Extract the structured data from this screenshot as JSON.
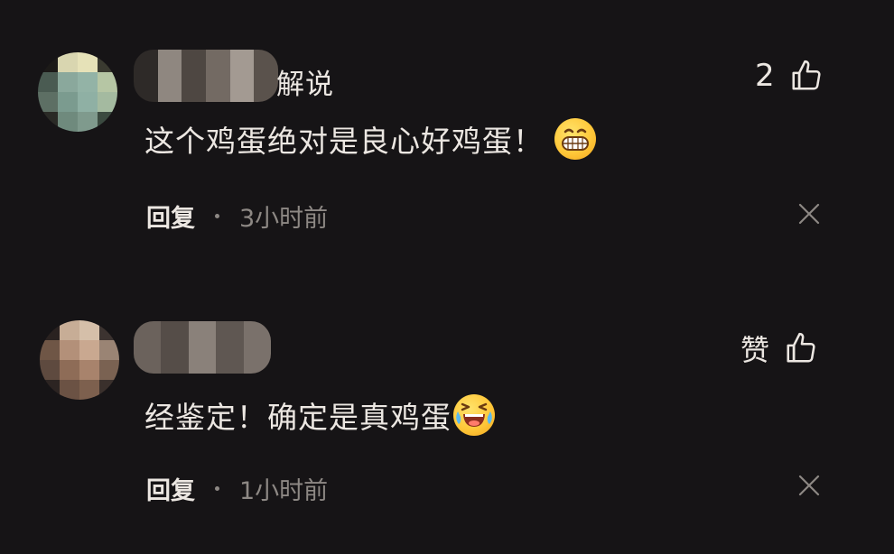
{
  "comments": [
    {
      "username_suffix": "解说",
      "text": "这个鸡蛋绝对是良心好鸡蛋！",
      "emoji": "grinning-face-emoji",
      "reply_label": "回复",
      "time": "3小时前",
      "like_label": "2"
    },
    {
      "username_suffix": "",
      "text": "经鉴定！确定是真鸡蛋",
      "emoji": "laughing-crying-face-emoji",
      "reply_label": "回复",
      "time": "1小时前",
      "like_label": "赞"
    }
  ],
  "colors": {
    "background": "#161416",
    "text": "#ece7e2",
    "muted": "#8d8884",
    "emoji_yellow": "#ffc83a"
  },
  "icons": [
    "thumbs-up-icon",
    "close-icon"
  ]
}
